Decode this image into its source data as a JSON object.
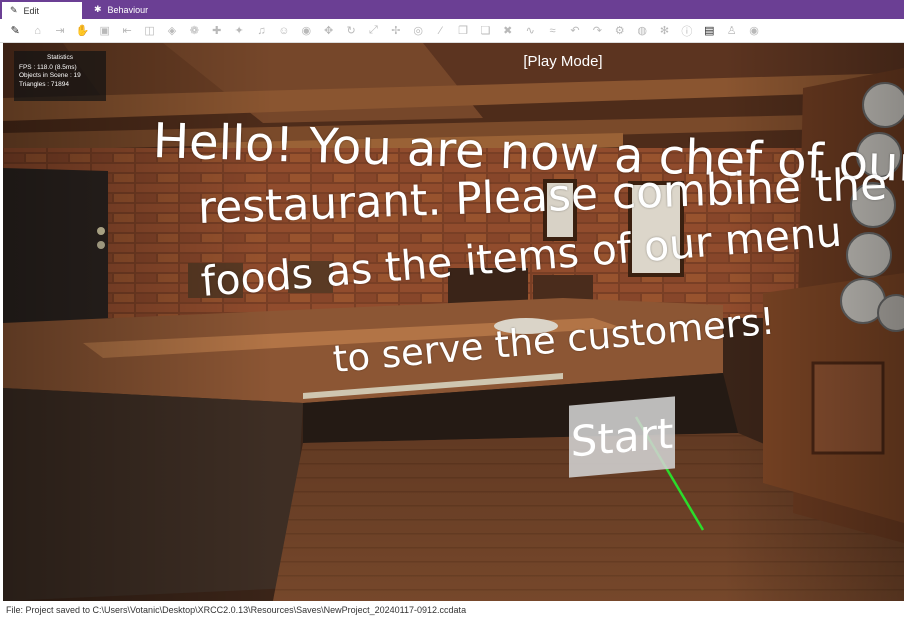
{
  "tabs": [
    {
      "label": "Edit",
      "icon": "edit-icon"
    },
    {
      "label": "Behaviour",
      "icon": "gear-icon"
    }
  ],
  "toolbar": {
    "icons": [
      "edit-icon",
      "home-icon",
      "export-icon",
      "hand-icon",
      "save-icon",
      "import-icon",
      "cube-import-icon",
      "cube-icon",
      "brain-icon",
      "hand-add-icon",
      "hand-link-icon",
      "sound-icon",
      "person-icon",
      "eye-icon",
      "move-icon",
      "rotate-icon",
      "scale-icon",
      "pivot-icon",
      "camera-icon",
      "link-icon",
      "copy-icon",
      "paste-icon",
      "delete-icon",
      "wave-icon",
      "wave-alt-icon",
      "undo-icon",
      "redo-icon",
      "settings-nodes-icon",
      "prefab-icon",
      "gear-icon",
      "info-icon",
      "preview-icon",
      "person-outline-icon",
      "target-icon"
    ]
  },
  "statistics": {
    "title": "Statistics",
    "fps": "FPS : 118.0 (8.5ms)",
    "objects": "Objects in Scene : 19",
    "triangles": "Triangles : 71894"
  },
  "mode_label": "[Play Mode]",
  "scene_message": {
    "line1": "Hello! You are now a chef of our",
    "line2": "restaurant. Please combine the",
    "line3": "foods as the items of our menu",
    "line4": "to serve the customers!"
  },
  "start_button": {
    "label": "Start"
  },
  "laser_color": "#2bdc2b",
  "status": {
    "text": "File: Project saved to C:\\Users\\Votanic\\Desktop\\XRCC2.0.13\\Resources\\Saves\\NewProject_20240117-0912.ccdata"
  }
}
